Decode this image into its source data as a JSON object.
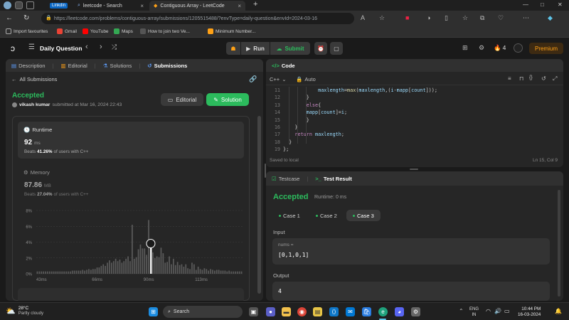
{
  "browser": {
    "tabs": [
      {
        "label": "LinkedIn",
        "badge": "Linkdin"
      },
      {
        "label": "leetcode - Search"
      },
      {
        "label": "Contiguous Array - LeetCode"
      }
    ],
    "url": "https://leetcode.com/problems/contiguous-array/submissions/1205515488/?envType=daily-question&envId=2024-03-16",
    "bookmarks": [
      "Import favourites",
      "Gmail",
      "YouTube",
      "Maps",
      "How to join two Ve...",
      "Minimum Number..."
    ]
  },
  "header": {
    "title": "Daily Question",
    "run_label": "Run",
    "submit_label": "Submit",
    "streak": "4",
    "premium_label": "Premium"
  },
  "left_panel": {
    "tabs": [
      "Description",
      "Editorial",
      "Solutions",
      "Submissions"
    ],
    "back_label": "All Submissions",
    "status": "Accepted",
    "user": "vikash kumar",
    "submitted_text": "submitted at Mar 16, 2024 22:43",
    "editorial_btn": "Editorial",
    "solution_btn": "Solution",
    "runtime": {
      "label": "Runtime",
      "value": "92",
      "unit": "ms",
      "beats_prefix": "Beats",
      "beats_pct": "41.26%",
      "beats_suffix": "of users with C++"
    },
    "memory": {
      "label": "Memory",
      "value": "87.86",
      "unit": "MB",
      "beats_prefix": "Beats",
      "beats_pct": "27.04%",
      "beats_suffix": "of users with C++"
    }
  },
  "chart_data": {
    "type": "bar",
    "ylabels": [
      "8%",
      "6%",
      "4%",
      "2%",
      "0%"
    ],
    "xlabels": [
      "43ms",
      "66ms",
      "90ms",
      "113ms"
    ],
    "ylim": [
      0,
      8
    ],
    "values": [
      0.3,
      0.3,
      0.3,
      0.3,
      0.3,
      0.3,
      0.3,
      0.3,
      0.3,
      0.3,
      0.3,
      0.3,
      0.3,
      0.3,
      0.3,
      0.3,
      0.3,
      0.4,
      0.4,
      0.4,
      0.4,
      0.4,
      0.5,
      0.4,
      0.5,
      0.6,
      0.5,
      0.6,
      0.6,
      0.8,
      0.8,
      1.0,
      1.2,
      1.0,
      1.4,
      1.7,
      1.4,
      1.6,
      1.9,
      1.6,
      1.8,
      1.4,
      1.6,
      1.9,
      2.2,
      1.6,
      6.2,
      1.9,
      2.1,
      3.1,
      3.7,
      3.2,
      3.2,
      2.4,
      6.8,
      3.7,
      2.7,
      2.0,
      2.2,
      2.1,
      3.3,
      2.6,
      1.4,
      1.5,
      2.2,
      1.2,
      1.9,
      1.1,
      1.5,
      1.1,
      1.2,
      0.9,
      1.2,
      0.7,
      0.6,
      1.4,
      1.2,
      0.5,
      0.9,
      0.6,
      0.5,
      0.7,
      0.6,
      0.4,
      0.6,
      0.5,
      0.4,
      0.5,
      0.5,
      0.4,
      0.4,
      0.4,
      0.3,
      0.4,
      0.3,
      0.3,
      0.3,
      0.3,
      0.3,
      0.3
    ],
    "highlight_index": 55,
    "highlight_value": 2.2
  },
  "code_panel": {
    "title": "Code",
    "language": "C++",
    "auto_label": "Auto",
    "saved_text": "Saved to local",
    "cursor_pos": "Ln 15, Col 9",
    "lines": [
      {
        "n": "11",
        "text": "            maxlength=max(maxlength,(i-mapp[count]));"
      },
      {
        "n": "12",
        "text": "        }"
      },
      {
        "n": "13",
        "text": "        else{"
      },
      {
        "n": "14",
        "text": "        mapp[count]=i;"
      },
      {
        "n": "15",
        "text": "        }"
      },
      {
        "n": "16",
        "text": "    }"
      },
      {
        "n": "17",
        "text": "    return maxlength;"
      },
      {
        "n": "18",
        "text": "  }"
      },
      {
        "n": "19",
        "text": "};"
      }
    ]
  },
  "test_panel": {
    "tabs": [
      "Testcase",
      "Test Result"
    ],
    "status": "Accepted",
    "runtime_text": "Runtime: 0 ms",
    "cases": [
      "Case 1",
      "Case 2",
      "Case 3"
    ],
    "input_label": "Input",
    "var_name": "nums =",
    "var_value": "[0,1,0,1]",
    "output_label": "Output",
    "output_value": "4"
  },
  "taskbar": {
    "weather_temp": "28°C",
    "weather_desc": "Partly cloudy",
    "search_label": "Search",
    "lang": "ENG",
    "region": "IN",
    "time": "10:44 PM",
    "date": "16-03-2024"
  }
}
